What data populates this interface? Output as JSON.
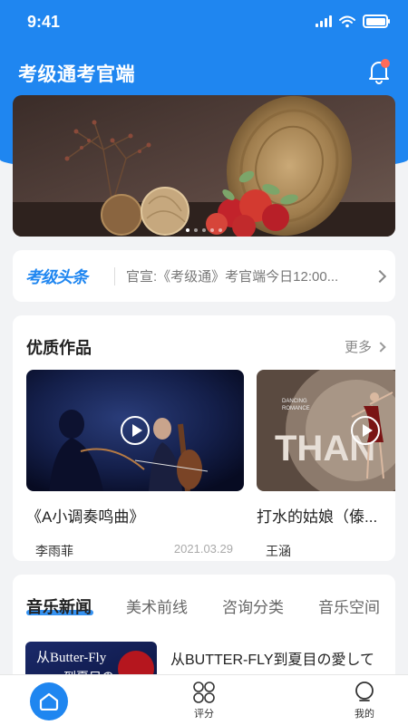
{
  "status_bar": {
    "time": "9:41"
  },
  "header": {
    "title": "考级通考官端"
  },
  "ticker": {
    "logo": "考级头条",
    "text": "官宣:《考级通》考官端今日12:00..."
  },
  "works_section": {
    "title": "优质作品",
    "more_label": "更多",
    "cards": [
      {
        "title": "《A小调奏鸣曲》",
        "author": "李雨菲",
        "date": "2021.03.29"
      },
      {
        "title": "打水的姑娘（傣...",
        "author": "王涵",
        "date": ""
      }
    ],
    "second_card_thumb_text": {
      "line1": "DANCING",
      "line2": "ROMANCE",
      "big": "THAN"
    }
  },
  "news_section": {
    "tabs": [
      "音乐新闻",
      "美术前线",
      "咨询分类",
      "音乐空间"
    ],
    "active_tab": 0,
    "items": [
      {
        "title": "从BUTTER-FLY到夏目の愛して",
        "thumb_text_1": "从Butter-Fly",
        "thumb_text_2": "到夏目の"
      }
    ]
  },
  "bottom_nav": {
    "items": [
      {
        "label": "",
        "icon": "home-icon",
        "active": true
      },
      {
        "label": "评分",
        "icon": "grid-icon"
      },
      {
        "label": "我的",
        "icon": "profile-icon"
      }
    ]
  },
  "colors": {
    "primary": "#1f86f0",
    "badge": "#ff6b5b",
    "background": "#f2f3f5"
  }
}
